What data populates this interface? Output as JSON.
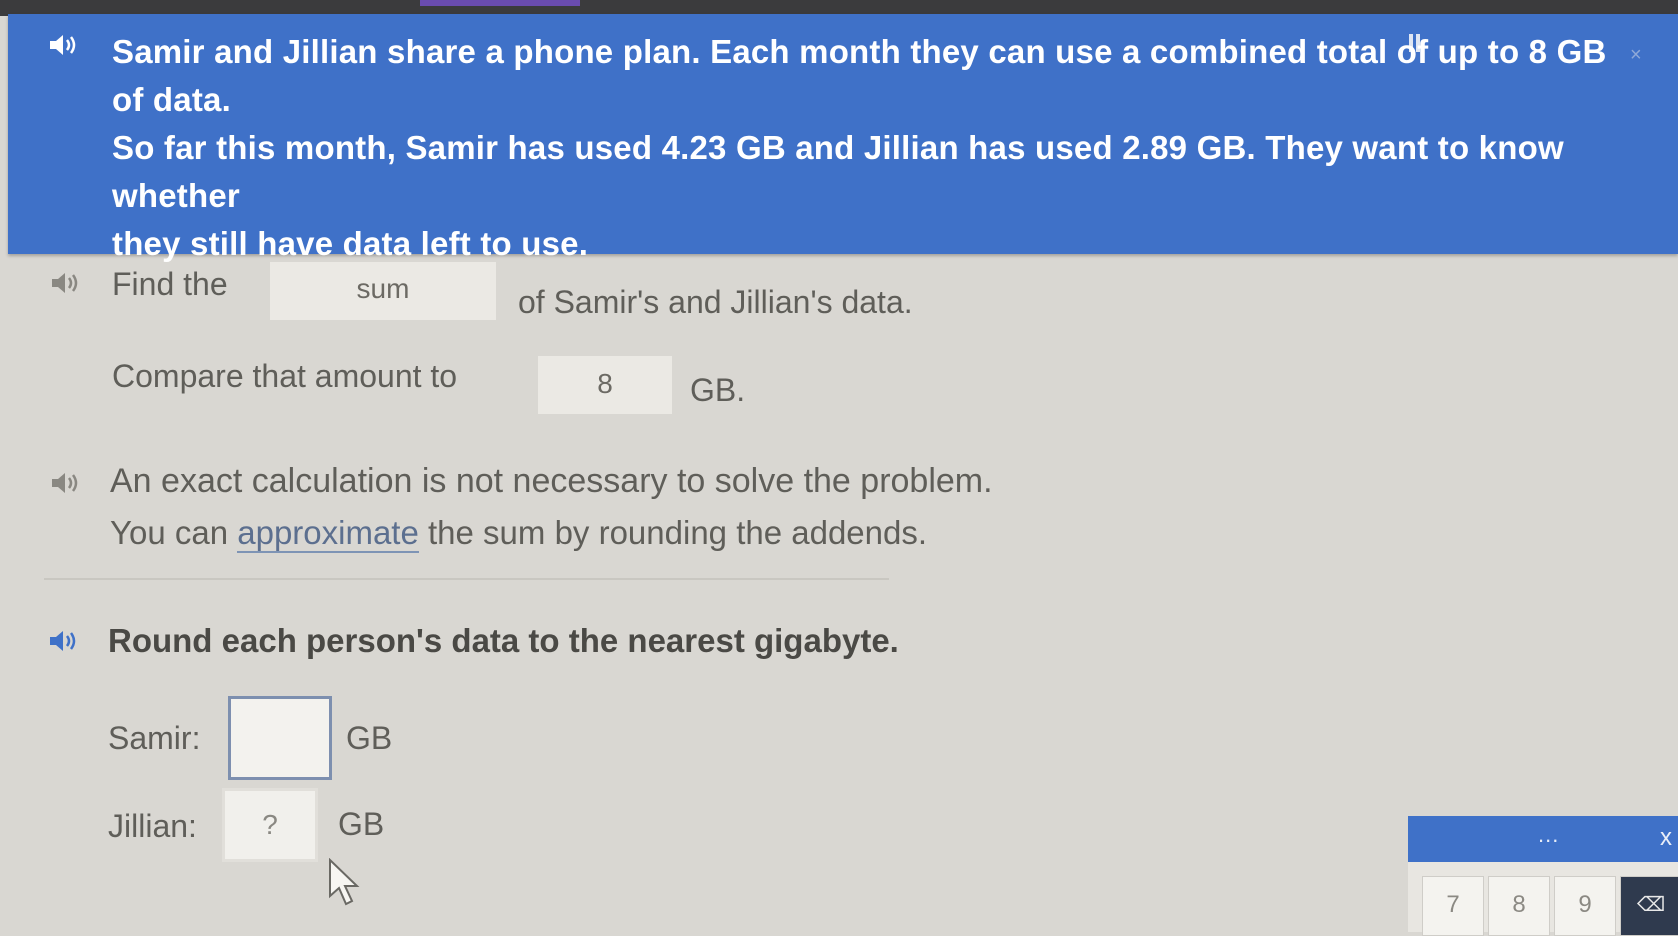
{
  "problem": {
    "line1": "Samir and Jillian share a phone plan. Each month they can use a combined total of up to 8 GB of data.",
    "line2": "So far this month, Samir has used 4.23 GB and Jillian has used 2.89 GB. They want to know whether",
    "line3": "they still have data left to use."
  },
  "step1": {
    "find_prefix": "Find the",
    "find_box": "sum",
    "find_suffix": "of Samir's and Jillian's data.",
    "compare_prefix": "Compare that amount to",
    "compare_box": "8",
    "compare_suffix": "GB."
  },
  "hint": {
    "line1": "An exact calculation is not necessary to solve the problem.",
    "line2_prefix": "You can",
    "line2_link": "approximate",
    "line2_suffix": "the sum by rounding the addends."
  },
  "task": {
    "instruction": "Round each person's data to the nearest gigabyte.",
    "samir_label": "Samir:",
    "samir_value": "",
    "samir_unit": "GB",
    "jillian_label": "Jillian:",
    "jillian_value": "?",
    "jillian_unit": "GB"
  },
  "keypad": {
    "menu": "...",
    "close": "x",
    "keys": [
      "7",
      "8",
      "9"
    ]
  },
  "icons": {
    "speaker": "speaker-icon",
    "pause": "pause-icon",
    "close": "close-icon",
    "cursor": "mouse-pointer-icon",
    "backspace": "backspace-icon"
  },
  "colors": {
    "banner": "#3f71c8",
    "background": "#d9d7d2",
    "text": "#5f5e59"
  }
}
